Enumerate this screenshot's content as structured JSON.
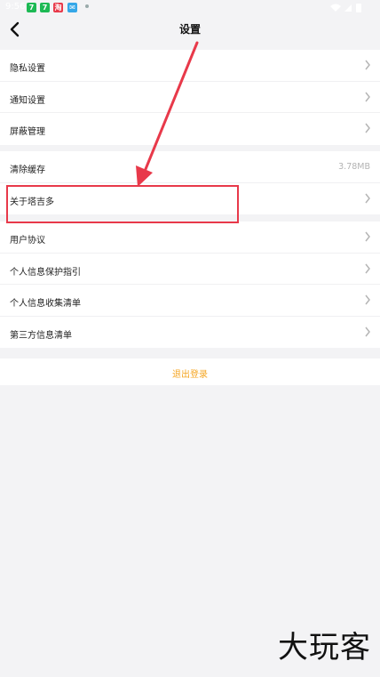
{
  "status_bar": {
    "time": "9:56",
    "app_icons": [
      "7",
      "7",
      "淘",
      "✉"
    ]
  },
  "header": {
    "title": "设置"
  },
  "group1": [
    {
      "label": "隐私设置"
    },
    {
      "label": "通知设置"
    },
    {
      "label": "屏蔽管理"
    }
  ],
  "group2": [
    {
      "label": "清除缓存",
      "value": "3.78MB"
    },
    {
      "label": "关于塔吉多"
    }
  ],
  "group3": [
    {
      "label": "用户协议"
    },
    {
      "label": "个人信息保护指引"
    },
    {
      "label": "个人信息收集清单"
    },
    {
      "label": "第三方信息清单"
    }
  ],
  "logout": {
    "label": "退出登录"
  },
  "watermark": "大玩客",
  "colors": {
    "background": "#f3f3f5",
    "accent": "#f5a623",
    "annotation": "#e8394a"
  }
}
